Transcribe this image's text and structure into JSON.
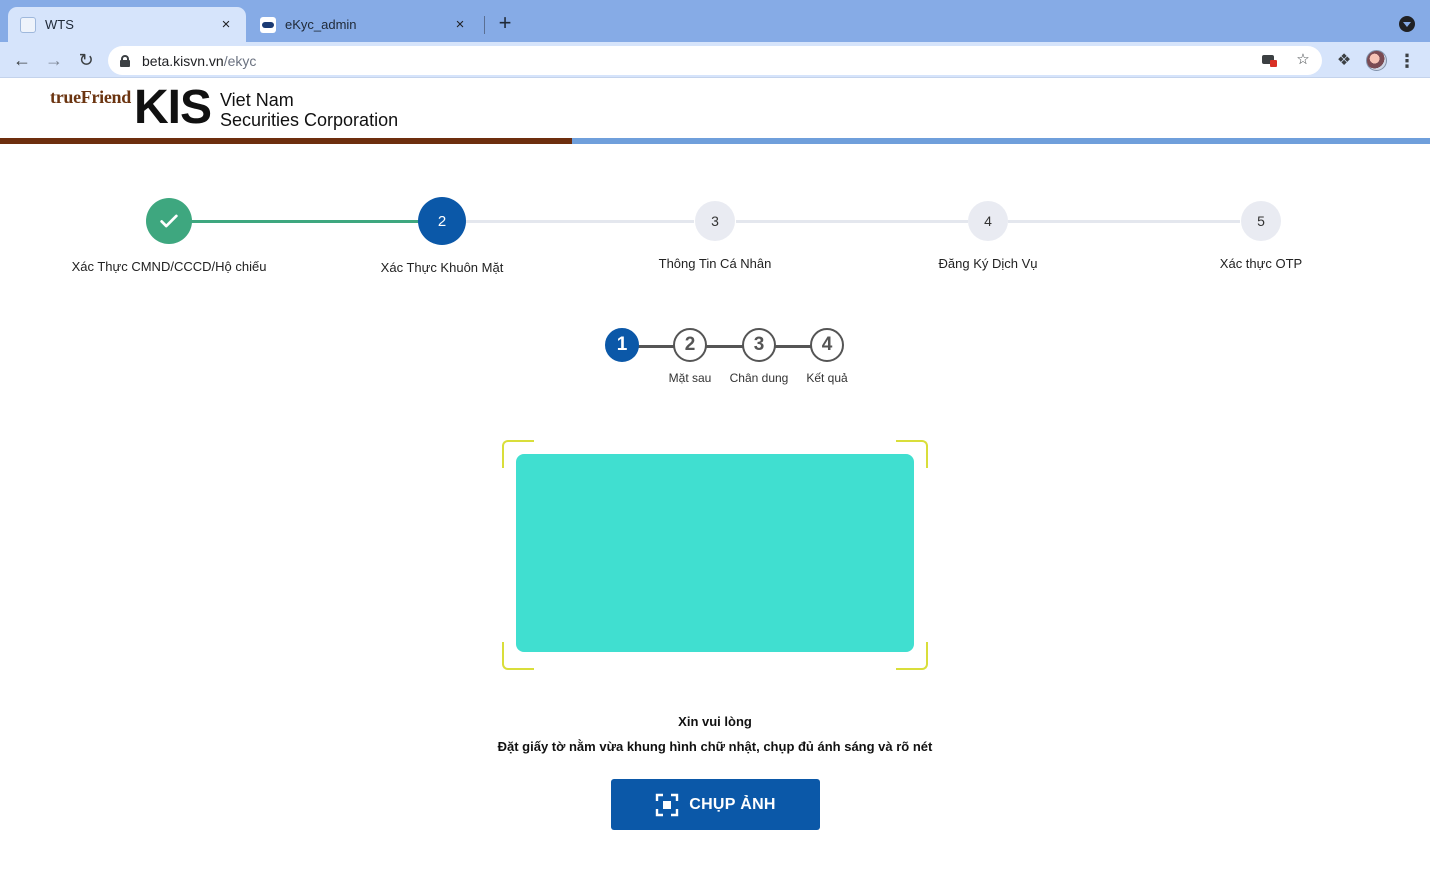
{
  "browser": {
    "tabs": [
      {
        "title": "WTS",
        "close": "×"
      },
      {
        "title": "eKyc_admin",
        "close": "×"
      }
    ],
    "new_tab": "+",
    "url_host": "beta.kisvn.vn",
    "url_path": "/ekyc"
  },
  "header": {
    "tagline": "trueFriend",
    "brand": "KIS",
    "brand_line1": "Viet Nam",
    "brand_line2": "Securities Corporation"
  },
  "steps": [
    {
      "number": "1",
      "label": "Xác Thực CMND/CCCD/Hộ chiếu",
      "state": "done"
    },
    {
      "number": "2",
      "label": "Xác Thực Khuôn Mặt",
      "state": "active"
    },
    {
      "number": "3",
      "label": "Thông Tin Cá Nhân",
      "state": "pending"
    },
    {
      "number": "4",
      "label": "Đăng Ký Dịch Vụ",
      "state": "pending"
    },
    {
      "number": "5",
      "label": "Xác thực OTP",
      "state": "pending"
    }
  ],
  "sub_steps": [
    {
      "number": "1",
      "label": "",
      "state": "active"
    },
    {
      "number": "2",
      "label": "Mặt sau",
      "state": "pending"
    },
    {
      "number": "3",
      "label": "Chân dung",
      "state": "pending"
    },
    {
      "number": "4",
      "label": "Kết quả",
      "state": "pending"
    }
  ],
  "instructions": {
    "title": "Xin vui lòng",
    "text": "Đặt giấy tờ nằm vừa khung hình chữ nhật, chụp đủ ánh sáng và rõ nét"
  },
  "capture_button": {
    "label": "CHỤP ẢNH",
    "icon": "capture-icon"
  },
  "colors": {
    "primary": "#0b58a8",
    "success": "#3ea77f",
    "preview": "#40dfd0",
    "frame": "#d9de3a",
    "brand_brown": "#6d2e0e",
    "brand_blue": "#6f9fdb"
  }
}
